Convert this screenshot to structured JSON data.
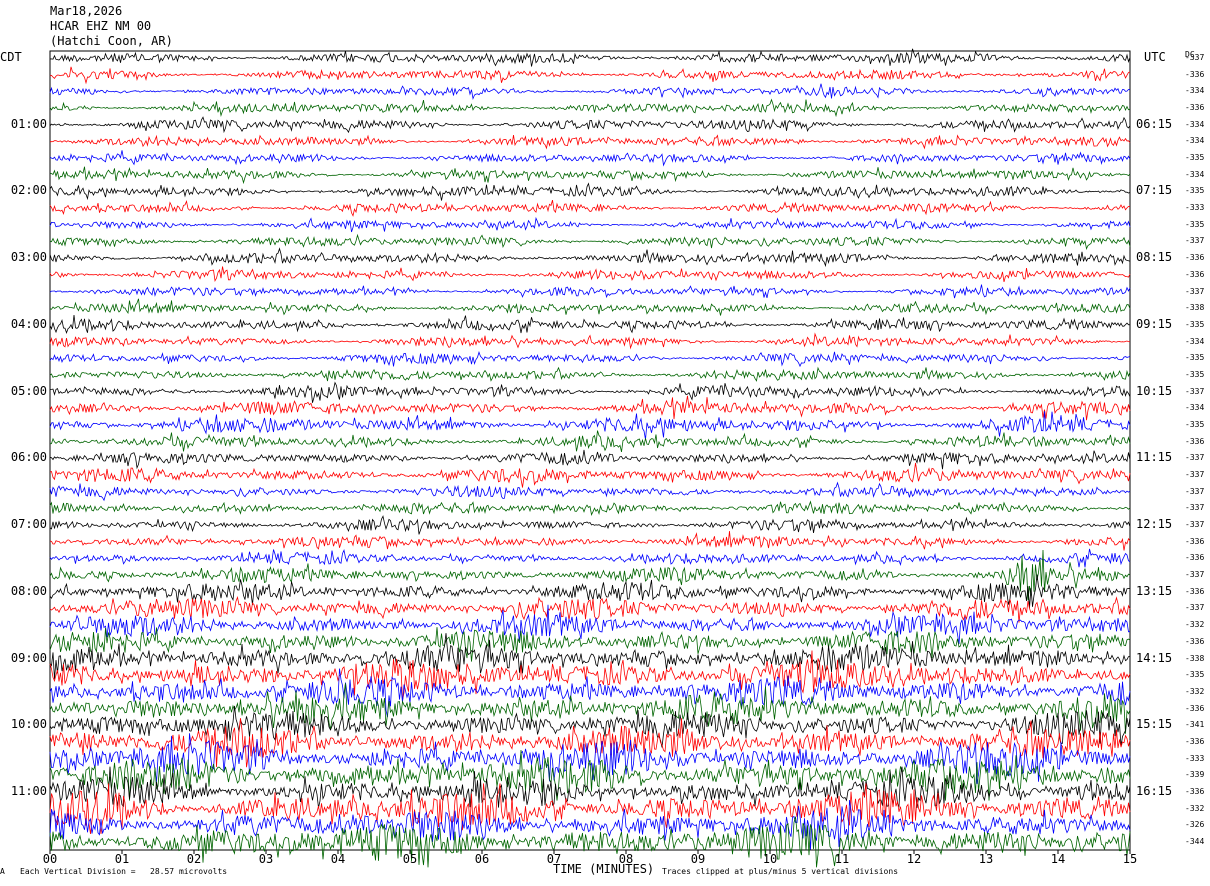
{
  "header": {
    "date": "Mar18,2026",
    "station": "HCAR EHZ NM 00",
    "location": "(Hatchi Coon, AR)"
  },
  "axes": {
    "left_tz": "CDT",
    "right_tz": "UTC",
    "dc_label": "DC",
    "xlabel": "TIME (MINUTES)"
  },
  "footer": {
    "scale_note": "Each Vertical Division =   28.57 microvolts",
    "clip_note": "Traces clipped at plus/minus 5 vertical divisions",
    "corner_mark": "A"
  },
  "colors": {
    "black": "#000000",
    "red": "#ff0000",
    "blue": "#0000ff",
    "green": "#006400"
  },
  "chart_data": {
    "type": "line",
    "title": "HCAR EHZ NM 00",
    "xlim": [
      0,
      15
    ],
    "x_ticks": [
      "00",
      "01",
      "02",
      "03",
      "04",
      "05",
      "06",
      "07",
      "08",
      "09",
      "10",
      "11",
      "12",
      "13",
      "14",
      "15"
    ],
    "trace_minutes": 15,
    "trace_color_cycle": [
      "black",
      "red",
      "blue",
      "green"
    ],
    "left_hour_labels": [
      {
        "trace": 4,
        "label": "01:00"
      },
      {
        "trace": 8,
        "label": "02:00"
      },
      {
        "trace": 12,
        "label": "03:00"
      },
      {
        "trace": 16,
        "label": "04:00"
      },
      {
        "trace": 20,
        "label": "05:00"
      },
      {
        "trace": 24,
        "label": "06:00"
      },
      {
        "trace": 28,
        "label": "07:00"
      },
      {
        "trace": 32,
        "label": "08:00"
      },
      {
        "trace": 36,
        "label": "09:00"
      },
      {
        "trace": 40,
        "label": "10:00"
      },
      {
        "trace": 44,
        "label": "11:00"
      }
    ],
    "right_hour_labels": [
      {
        "trace": 4,
        "label": "06:15"
      },
      {
        "trace": 8,
        "label": "07:15"
      },
      {
        "trace": 12,
        "label": "08:15"
      },
      {
        "trace": 16,
        "label": "09:15"
      },
      {
        "trace": 20,
        "label": "10:15"
      },
      {
        "trace": 24,
        "label": "11:15"
      },
      {
        "trace": 28,
        "label": "12:15"
      },
      {
        "trace": 32,
        "label": "13:15"
      },
      {
        "trace": 36,
        "label": "14:15"
      },
      {
        "trace": 40,
        "label": "15:15"
      },
      {
        "trace": 44,
        "label": "16:15"
      }
    ],
    "dc_offsets": [
      "-337",
      "-336",
      "-334",
      "-336",
      "-334",
      "-334",
      "-335",
      "-334",
      "-335",
      "-333",
      "-335",
      "-337",
      "-336",
      "-336",
      "-337",
      "-338",
      "-335",
      "-334",
      "-335",
      "-335",
      "-337",
      "-334",
      "-335",
      "-336",
      "-337",
      "-337",
      "-337",
      "-337",
      "-337",
      "-336",
      "-336",
      "-337",
      "-336",
      "-337",
      "-332",
      "-336",
      "-338",
      "-335",
      "-332",
      "-336",
      "-341",
      "-336",
      "-333",
      "-339",
      "-336",
      "-332",
      "-326",
      "-344"
    ],
    "amplitude_divisions": [
      1.2,
      1.1,
      1.0,
      1.1,
      1.2,
      1.1,
      1.0,
      1.1,
      1.2,
      1.1,
      1.0,
      1.1,
      1.2,
      1.1,
      1.0,
      1.1,
      1.2,
      1.1,
      1.1,
      1.2,
      1.3,
      1.5,
      1.7,
      1.3,
      1.3,
      1.5,
      1.2,
      1.2,
      1.2,
      1.3,
      1.2,
      1.6,
      2.0,
      2.2,
      2.3,
      2.5,
      3.0,
      3.5,
      3.2,
      3.3,
      3.0,
      3.4,
      3.6,
      3.8,
      3.2,
      3.8,
      3.5,
      4.0
    ],
    "events": [
      {
        "trace": 31,
        "minute": 13.6,
        "amplitude_divisions": 5
      }
    ],
    "clip_divisions": 5
  }
}
